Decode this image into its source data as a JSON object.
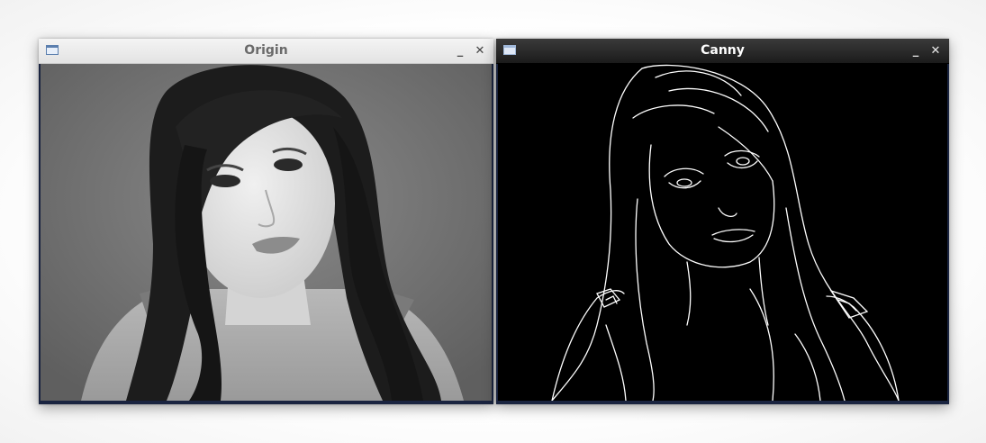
{
  "windows": [
    {
      "title": "Origin",
      "icon": "window-app-icon",
      "controls": {
        "minimize": "_",
        "close": "✕"
      },
      "content": "grayscale-portrait"
    },
    {
      "title": "Canny",
      "icon": "window-app-icon",
      "controls": {
        "minimize": "_",
        "close": "✕"
      },
      "content": "canny-edge-map"
    }
  ],
  "colors": {
    "title_light": "#6a6a6a",
    "title_dark": "#ffffff",
    "edge_background": "#000000",
    "edge_lines": "#ffffff"
  }
}
